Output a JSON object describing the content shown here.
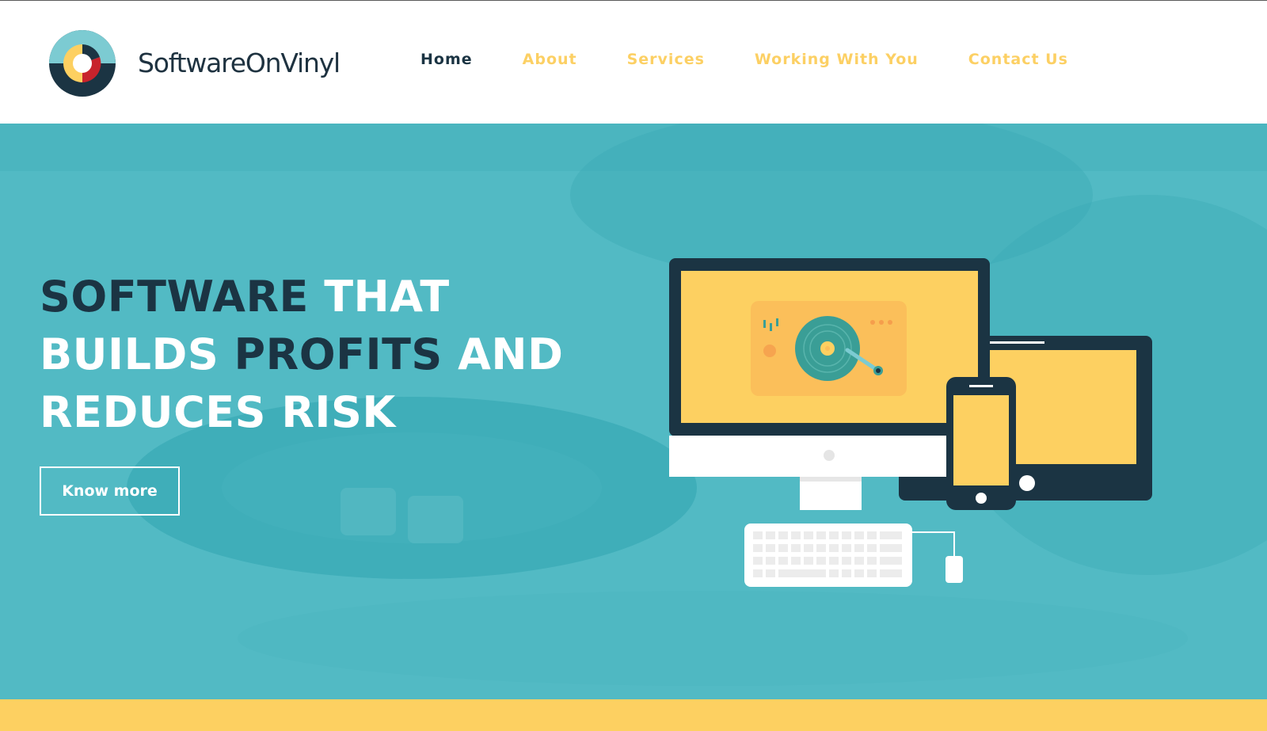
{
  "brand": {
    "name": "SoftwareOnVinyl",
    "logo_icon": "vinyl-logo-icon"
  },
  "nav": {
    "items": [
      {
        "label": "Home",
        "active": true
      },
      {
        "label": "About",
        "active": false
      },
      {
        "label": "Services",
        "active": false
      },
      {
        "label": "Working With You",
        "active": false
      },
      {
        "label": "Contact Us",
        "active": false
      }
    ]
  },
  "hero": {
    "headline_parts": [
      {
        "text": "SOFTWARE",
        "tone": "dark"
      },
      {
        "text": " THAT",
        "tone": "light"
      },
      {
        "text": "BUILDS",
        "tone": "light"
      },
      {
        "text": " PROFITS",
        "tone": "dark"
      },
      {
        "text": " AND",
        "tone": "light"
      },
      {
        "text": "REDUCES RISK",
        "tone": "light"
      }
    ],
    "cta_label": "Know more",
    "illustration": "devices-turntable-illustration"
  },
  "colors": {
    "accent_yellow": "#fdd061",
    "teal": "#52bac4",
    "navy": "#1b3443",
    "red": "#c8232c"
  }
}
